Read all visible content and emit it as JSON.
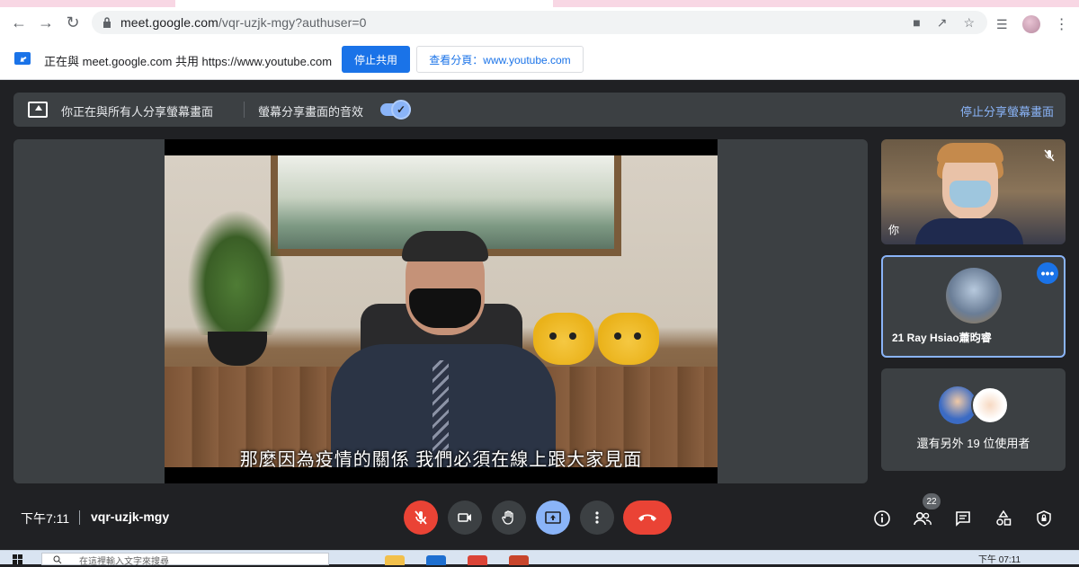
{
  "browser": {
    "url_host": "meet.google.com",
    "url_path": "/vqr-uzjk-mgy?authuser=0"
  },
  "sharebar": {
    "message": "正在與 meet.google.com 共用 https://www.youtube.com",
    "stop_label": "停止共用",
    "view_tab_label": "查看分頁：www.youtube.com"
  },
  "present": {
    "sharing_text": "你正在與所有人分享螢幕畫面",
    "audio_text": "螢幕分享畫面的音效",
    "audio_enabled": true,
    "stop_label": "停止分享螢幕畫面"
  },
  "stage": {
    "caption": "那麼因為疫情的關係 我們必須在線上跟大家見面"
  },
  "participants": {
    "self_label": "你",
    "ray_name": "21 Ray Hsiao蕭昀睿",
    "others_label": "還有另外 19 位使用者"
  },
  "meeting": {
    "time": "下午7:11",
    "code": "vqr-uzjk-mgy",
    "participant_count": "22"
  },
  "controls": {
    "icons": [
      "mic-off-icon",
      "camera-icon",
      "raise-hand-icon",
      "present-icon",
      "more-options-icon",
      "end-call-icon"
    ],
    "right_icons": [
      "info-icon",
      "people-icon",
      "chat-icon",
      "activities-icon",
      "host-controls-icon"
    ]
  },
  "taskbar": {
    "search_placeholder": "在這裡輸入文字來搜尋",
    "clock": "下午 07:11"
  },
  "colors": {
    "meet_bg": "#202124",
    "accent_blue": "#1a73e8",
    "end_red": "#ea4335",
    "light_blue": "#8ab4f8"
  }
}
